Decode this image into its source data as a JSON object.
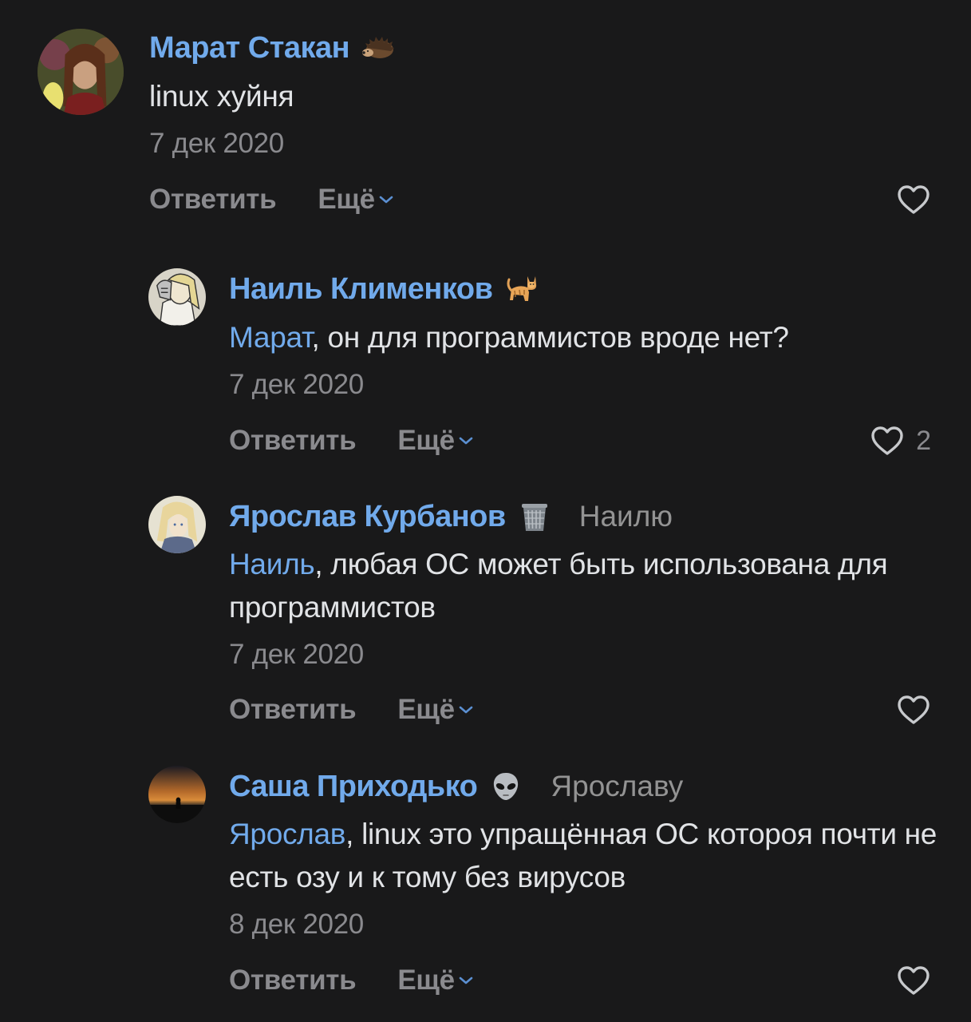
{
  "comments": [
    {
      "author": "Марат Стакан",
      "emoji_icon": "hedgehog-icon",
      "reply_to": "",
      "mention": "",
      "text": "linux хуйня",
      "date": "7 дек 2020",
      "reply_label": "Ответить",
      "more_label": "Ещё",
      "likes": ""
    },
    {
      "author": "Наиль Клименков",
      "emoji_icon": "cat-icon",
      "reply_to": "",
      "mention": "Марат",
      "text": ", он для программистов вроде нет?",
      "date": "7 дек 2020",
      "reply_label": "Ответить",
      "more_label": "Ещё",
      "likes": "2"
    },
    {
      "author": "Ярослав Курбанов",
      "emoji_icon": "trash-bin-icon",
      "reply_to": "Наилю",
      "mention": "Наиль",
      "text": ", любая ОС может быть использована для программистов",
      "date": "7 дек 2020",
      "reply_label": "Ответить",
      "more_label": "Ещё",
      "likes": ""
    },
    {
      "author": "Саша Приходько",
      "emoji_icon": "alien-icon",
      "reply_to": "Ярославу",
      "mention": "Ярослав",
      "text": ", linux это упращённая ОС котороя почти не есть озу и к тому без вирусов",
      "date": "8 дек 2020",
      "reply_label": "Ответить",
      "more_label": "Ещё",
      "likes": ""
    }
  ],
  "colors": {
    "background": "#19191a",
    "accent": "#71aaeb",
    "text": "#e1e3e6",
    "secondary": "#8a8a8e"
  }
}
